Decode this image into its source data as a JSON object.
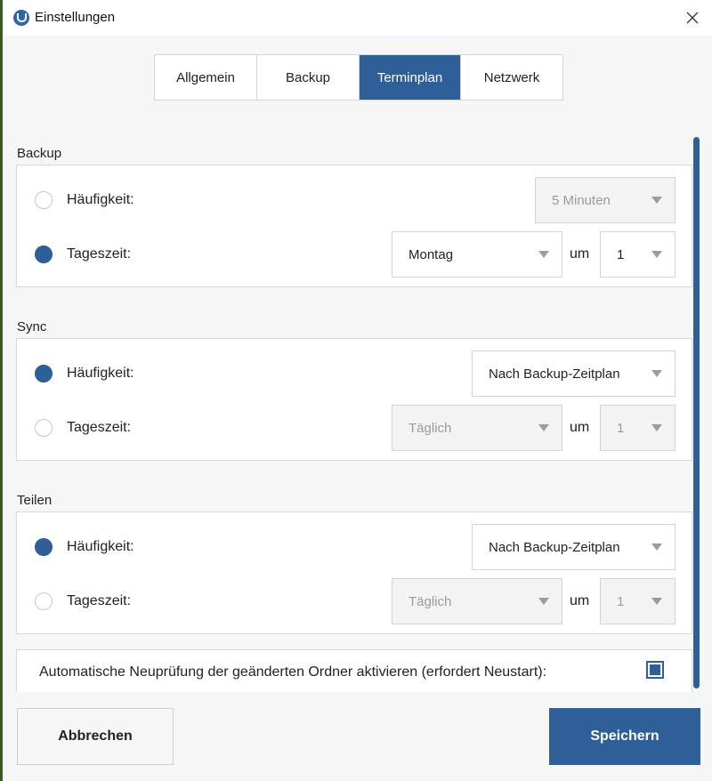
{
  "window": {
    "title": "Einstellungen"
  },
  "tabs": [
    {
      "label": "Allgemein",
      "active": false
    },
    {
      "label": "Backup",
      "active": false
    },
    {
      "label": "Terminplan",
      "active": true
    },
    {
      "label": "Netzwerk",
      "active": false
    }
  ],
  "sections": {
    "backup": {
      "title": "Backup",
      "frequency": {
        "label": "Häufigkeit:",
        "selected": false,
        "value": "5 Minuten"
      },
      "time_of_day": {
        "label": "Tageszeit:",
        "selected": true,
        "day": "Montag",
        "at_label": "um",
        "hour": "1"
      }
    },
    "sync": {
      "title": "Sync",
      "frequency": {
        "label": "Häufigkeit:",
        "selected": true,
        "value": "Nach Backup-Zeitplan"
      },
      "time_of_day": {
        "label": "Tageszeit:",
        "selected": false,
        "day": "Täglich",
        "at_label": "um",
        "hour": "1"
      }
    },
    "share": {
      "title": "Teilen",
      "frequency": {
        "label": "Häufigkeit:",
        "selected": true,
        "value": "Nach Backup-Zeitplan"
      },
      "time_of_day": {
        "label": "Tageszeit:",
        "selected": false,
        "day": "Täglich",
        "at_label": "um",
        "hour": "1"
      }
    }
  },
  "auto_rescan": {
    "label": "Automatische Neuprüfung der geänderten Ordner aktivieren (erfordert Neustart):",
    "checked": true
  },
  "footer": {
    "cancel_label": "Abbrechen",
    "save_label": "Speichern"
  },
  "colors": {
    "accent": "#2f5f98",
    "background": "#f6f6f6",
    "border": "#d8d8d8"
  }
}
